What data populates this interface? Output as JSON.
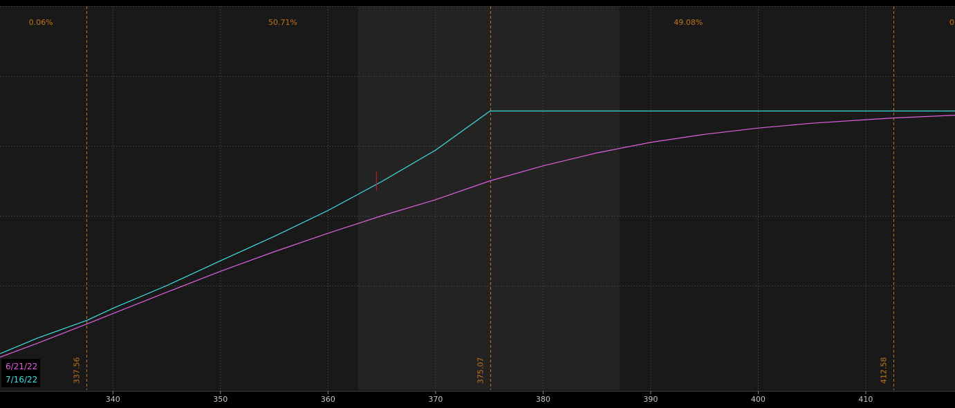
{
  "chart_data": {
    "type": "line",
    "title": "",
    "xlabel": "",
    "ylabel": "",
    "xlim": [
      329.5,
      418.3
    ],
    "ylim": [
      0,
      1
    ],
    "grid": true,
    "x_ticks": [
      340,
      350,
      360,
      370,
      380,
      390,
      400,
      410
    ],
    "x_tick_labels": [
      "340",
      "350",
      "360",
      "370",
      "380",
      "390",
      "400",
      "410"
    ],
    "y_grid_values": [
      0.2,
      0.4,
      0.6,
      0.8,
      1.0
    ],
    "probabilities": [
      {
        "label": "0.06%",
        "x": 333.3
      },
      {
        "label": "50.71%",
        "x": 355.8
      },
      {
        "label": "49.08%",
        "x": 393.5
      },
      {
        "label": "0",
        "x": 418.0
      }
    ],
    "shaded_range": [
      362.8,
      387.1
    ],
    "vertical_markers": [
      {
        "value": 337.56,
        "label": "337.56"
      },
      {
        "value": 375.07,
        "label": "375.07"
      },
      {
        "value": 412.58,
        "label": "412.58"
      }
    ],
    "series": [
      {
        "name": "6/21/22",
        "color": "#e060e0",
        "x": [
          329.5,
          333,
          337.56,
          340,
          345,
          350,
          355,
          360,
          365,
          370,
          375.07,
          380,
          385,
          390,
          395,
          400,
          405,
          410,
          412.58,
          418.3
        ],
        "y": [
          -0.005,
          0.035,
          0.09,
          0.12,
          0.181,
          0.241,
          0.297,
          0.35,
          0.4,
          0.446,
          0.5,
          0.543,
          0.58,
          0.61,
          0.633,
          0.651,
          0.665,
          0.675,
          0.68,
          0.688
        ]
      },
      {
        "name": "7/16/22",
        "color": "#40e0e0",
        "x": [
          329.5,
          333,
          337.56,
          340,
          345,
          350,
          355,
          360,
          365,
          370,
          374.3,
          375.07,
          418.3
        ],
        "y": [
          0.005,
          0.05,
          0.1,
          0.135,
          0.2,
          0.271,
          0.341,
          0.415,
          0.498,
          0.588,
          0.683,
          0.7,
          0.7
        ]
      }
    ],
    "marker": {
      "x": 364.5,
      "y": 0.5,
      "color": "#cc2020"
    },
    "legend": "bottom-left",
    "colors": {
      "background": "#000000",
      "panel": "#191919",
      "shaded": "#232323",
      "grid": "#3c3c3c",
      "markers": "#c27418",
      "prob_text": "#c27418"
    }
  }
}
